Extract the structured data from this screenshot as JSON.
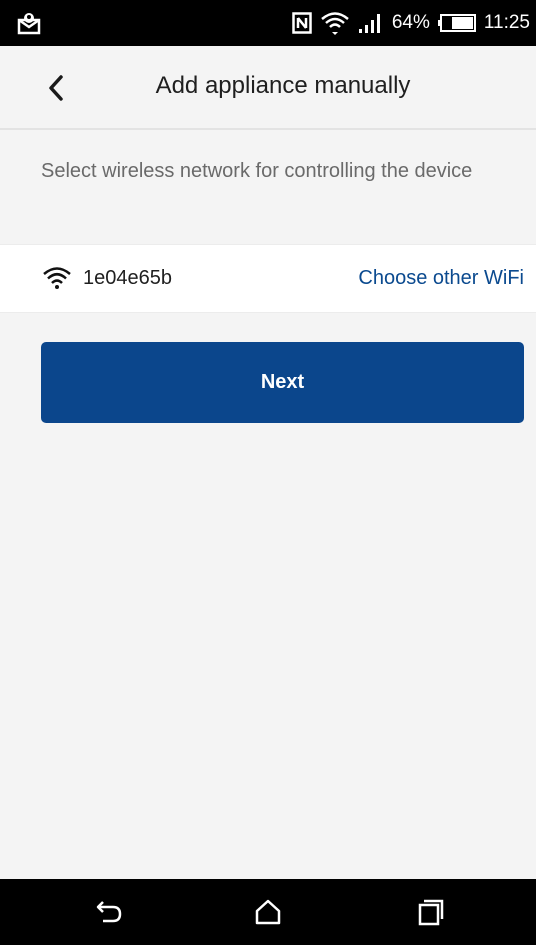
{
  "status_bar": {
    "battery": "64%",
    "time": "11:25",
    "icons": [
      "notification-icon",
      "nfc-icon",
      "wifi-icon",
      "signal-icon",
      "battery-icon"
    ]
  },
  "header": {
    "title": "Add appliance manually",
    "back_icon": "chevron-left-icon"
  },
  "instruction": "Select wireless network for controlling the device",
  "wifi": {
    "icon": "wifi-icon",
    "ssid": "1e04e65b",
    "choose_label": "Choose other WiFi"
  },
  "next_button": {
    "label": "Next"
  },
  "nav_bar": {
    "icons": [
      "back-icon",
      "home-icon",
      "recent-apps-icon"
    ]
  },
  "colors": {
    "accent": "#0b468c",
    "link": "#0b4a8f",
    "background": "#f4f4f4",
    "status_bar": "#000000"
  }
}
